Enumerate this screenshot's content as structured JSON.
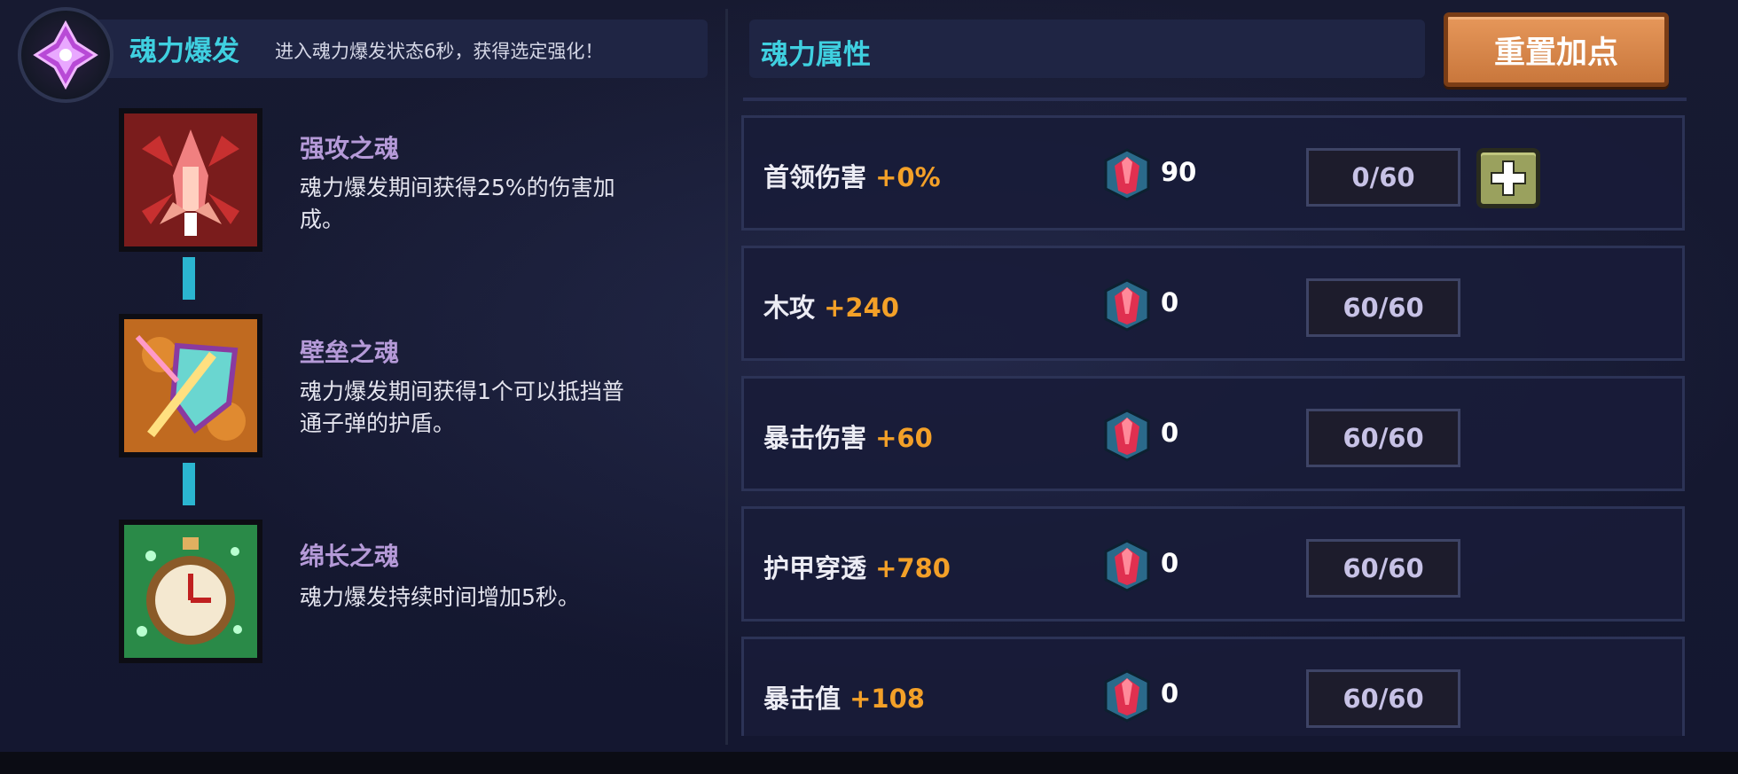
{
  "burst": {
    "title": "魂力爆发",
    "description": "进入魂力爆发状态6秒，获得选定强化！"
  },
  "skills": [
    {
      "name": "强攻之魂",
      "desc_line1": "魂力爆发期间获得25%的伤害加",
      "desc_line2": "成。",
      "icon": "red-rocket-icon"
    },
    {
      "name": "壁垒之魂",
      "desc_line1": "魂力爆发期间获得1个可以抵挡普",
      "desc_line2": "通子弹的护盾。",
      "icon": "shield-sword-icon"
    },
    {
      "name": "绵长之魂",
      "desc_line1": "魂力爆发持续时间增加5秒。",
      "desc_line2": "",
      "icon": "stopwatch-icon"
    }
  ],
  "attributes": {
    "title": "魂力属性",
    "reset_label": "重置加点",
    "rows": [
      {
        "name": "首领伤害",
        "bonus": "+0%",
        "cost": "90",
        "level": "0/60",
        "has_plus": true
      },
      {
        "name": "木攻",
        "bonus": "+240",
        "cost": "0",
        "level": "60/60",
        "has_plus": false
      },
      {
        "name": "暴击伤害",
        "bonus": "+60",
        "cost": "0",
        "level": "60/60",
        "has_plus": false
      },
      {
        "name": "护甲穿透",
        "bonus": "+780",
        "cost": "0",
        "level": "60/60",
        "has_plus": false
      },
      {
        "name": "暴击值",
        "bonus": "+108",
        "cost": "0",
        "level": "60/60",
        "has_plus": false
      }
    ]
  },
  "colors": {
    "accent_title": "#3fd0e0",
    "bonus": "#f3a028",
    "skill_name": "#b59ad8",
    "reset_button": "#d9864a"
  }
}
